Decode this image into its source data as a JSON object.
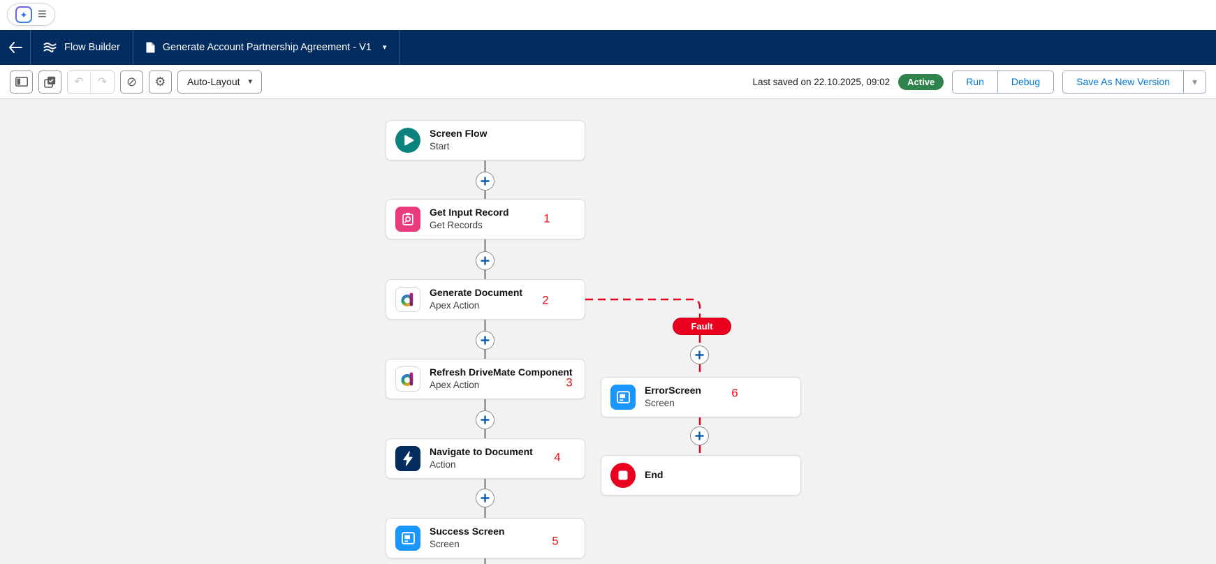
{
  "header": {
    "product": "Flow Builder",
    "flow_title": "Generate Account Partnership Agreement - V1"
  },
  "toolbar": {
    "auto_layout_label": "Auto-Layout",
    "last_saved": "Last saved on 22.10.2025, 09:02",
    "status_badge": "Active",
    "run_label": "Run",
    "debug_label": "Debug",
    "save_label": "Save As New Version"
  },
  "flow": {
    "fault_label": "Fault",
    "nodes": [
      {
        "title": "Screen Flow",
        "subtitle": "Start",
        "annotation": ""
      },
      {
        "title": "Get Input Record",
        "subtitle": "Get Records",
        "annotation": "1"
      },
      {
        "title": "Generate Document",
        "subtitle": "Apex Action",
        "annotation": "2"
      },
      {
        "title": "Refresh DriveMate Component",
        "subtitle": "Apex Action",
        "annotation": "3"
      },
      {
        "title": "Navigate to Document",
        "subtitle": "Action",
        "annotation": "4"
      },
      {
        "title": "Success Screen",
        "subtitle": "Screen",
        "annotation": "5"
      },
      {
        "title": "ErrorScreen",
        "subtitle": "Screen",
        "annotation": "6"
      },
      {
        "title": "End",
        "subtitle": "",
        "annotation": ""
      }
    ]
  },
  "icons": {
    "sparkle": "✦",
    "hamburger": "≡",
    "caret_down": "▾",
    "undo": "↶",
    "redo": "↷",
    "prohibit": "⊘",
    "gear": "⚙"
  },
  "colors": {
    "header_bg": "#032d60",
    "brand_blue": "#0176d3",
    "active_green": "#2e844a",
    "fault_red": "#ea001e",
    "start_teal": "#0b827c",
    "get_records_pink": "#e93a7b",
    "screen_blue": "#1b96ff",
    "action_navy": "#032d60",
    "canvas_bg": "#f3f2f2"
  }
}
